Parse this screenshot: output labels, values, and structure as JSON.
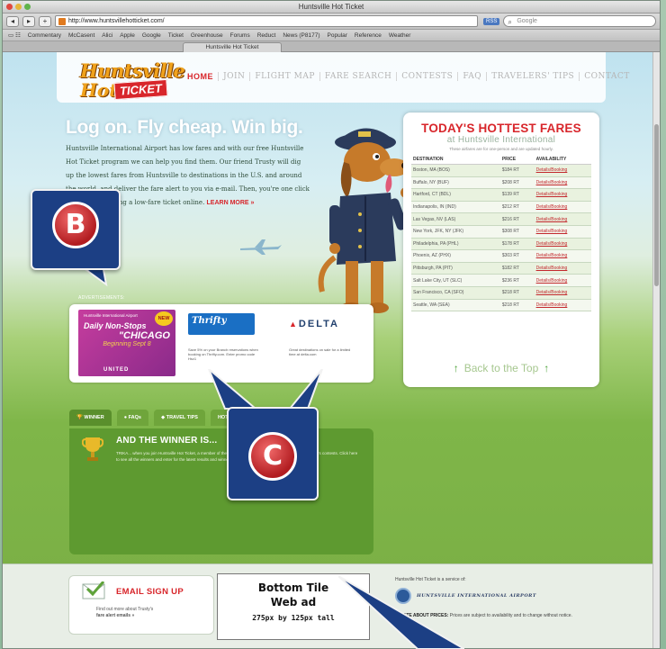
{
  "browser": {
    "window_title": "Huntsville Hot Ticket",
    "url": "http://www.huntsvillehotticket.com/",
    "rss_label": "RSS",
    "search_placeholder": "Google",
    "tab_label": "Huntsville Hot Ticket",
    "bookmarks": [
      "Commentary",
      "McCasent",
      "Alici",
      "Apple",
      "Google",
      "Ticket",
      "Greenhouse",
      "Forums",
      "Reduct",
      "News (P8177)",
      "Popular",
      "Reference",
      "Weather"
    ]
  },
  "site": {
    "logo_line1": "Huntsville",
    "logo_line2": "Hot",
    "logo_ticket": "TICKET",
    "nav": [
      "HOME",
      "JOIN",
      "FLIGHT MAP",
      "FARE SEARCH",
      "CONTESTS",
      "FAQ",
      "TRAVELERS' TIPS",
      "CONTACT"
    ],
    "headline": "Log on. Fly cheap. Win big.",
    "intro": "Huntsville International Airport has low fares and with our free Huntsville Hot Ticket program we can help you find them. Our friend Trusty will dig up the lowest fares from Huntsville to destinations in the U.S. and around the world, and deliver the fare alert to you via e-mail. Then, you're one click away from booking a low-fare ticket online.",
    "intro_more": "LEARN MORE »"
  },
  "fares": {
    "title": "TODAY'S HOTTEST FARES",
    "subtitle": "at Huntsville International",
    "note": "These airfares are for one-person and are updated hourly.",
    "columns": [
      "DESTINATION",
      "PRICE",
      "AVAILABILITY"
    ],
    "rows": [
      {
        "dest": "Boston, MA (BOS)",
        "price": "$184 RT",
        "link": "Details/Booking"
      },
      {
        "dest": "Buffalo, NY (BUF)",
        "price": "$208 RT",
        "link": "Details/Booking"
      },
      {
        "dest": "Hartford, CT (BDL)",
        "price": "$139 RT",
        "link": "Details/Booking"
      },
      {
        "dest": "Indianapolis, IN (IND)",
        "price": "$212 RT",
        "link": "Details/Booking"
      },
      {
        "dest": "Las Vegas, NV (LAS)",
        "price": "$216 RT",
        "link": "Details/Booking"
      },
      {
        "dest": "New York, JFK, NY (JFK)",
        "price": "$308 RT",
        "link": "Details/Booking"
      },
      {
        "dest": "Philadelphia, PA (PHL)",
        "price": "$178 RT",
        "link": "Details/Booking"
      },
      {
        "dest": "Phoenix, AZ (PHX)",
        "price": "$303 RT",
        "link": "Details/Booking"
      },
      {
        "dest": "Pittsburgh, PA (PIT)",
        "price": "$182 RT",
        "link": "Details/Booking"
      },
      {
        "dest": "Salt Lake City, UT (SLC)",
        "price": "$236 RT",
        "link": "Details/Booking"
      },
      {
        "dest": "San Francisco, CA (SFO)",
        "price": "$218 RT",
        "link": "Details/Booking"
      },
      {
        "dest": "Seattle, WA (SEA)",
        "price": "$218 RT",
        "link": "Details/Booking"
      }
    ],
    "back_to_top": "Back to the Top"
  },
  "ads": {
    "label": "ADVERTISEMENTS:",
    "ad1_small": "Huntsville International Airport",
    "ad1_big": "Daily Non-Stops",
    "ad1_city": "\"CHICAGO",
    "ad1_promo": "Beginning Sept 8",
    "ad1_brand": "UNITED",
    "ad1_star": "NEW",
    "ad2_brand": "Thrifty",
    "ad2_text": "Save 5% on your Branch reservations when booking on Thrifty.com. Enter promo code Hsv1",
    "ad3_brand": "DELTA",
    "ad3_text": "Great destinations on sale for a limited time at delta.com"
  },
  "winner": {
    "tabs": [
      "WINNER",
      "FAQs",
      "TRAVEL TIPS",
      "HOT LINE"
    ],
    "title": "AND THE WINNER IS...",
    "text": "TRIKA... when you join Huntsville Hot Ticket, a member of the Hot Ticket program, you become eligible for Trusty's contests. Click here to see all the winners and enter for the latest results and winners."
  },
  "footer": {
    "email_title": "EMAIL SIGN UP",
    "email_text_1": "Find out more about Trusty's",
    "email_text_2": "fare alert emails »",
    "tile_line1": "Bottom Tile",
    "tile_line2": "Web ad",
    "tile_line3": "275px by 125px tall",
    "service": "Huntsville Hot Ticket is a service of:",
    "airport": "HUNTSVILLE INTERNATIONAL AIRPORT",
    "price_note_bold": "A NOTE ABOUT PRICES:",
    "price_note": "Prices are subject to availability and to change without notice."
  },
  "callouts": {
    "b": "B",
    "c": "C"
  },
  "colors": {
    "accent_red": "#d8262b",
    "callout_blue": "#1c3f84",
    "grass_green": "#79ad44"
  }
}
